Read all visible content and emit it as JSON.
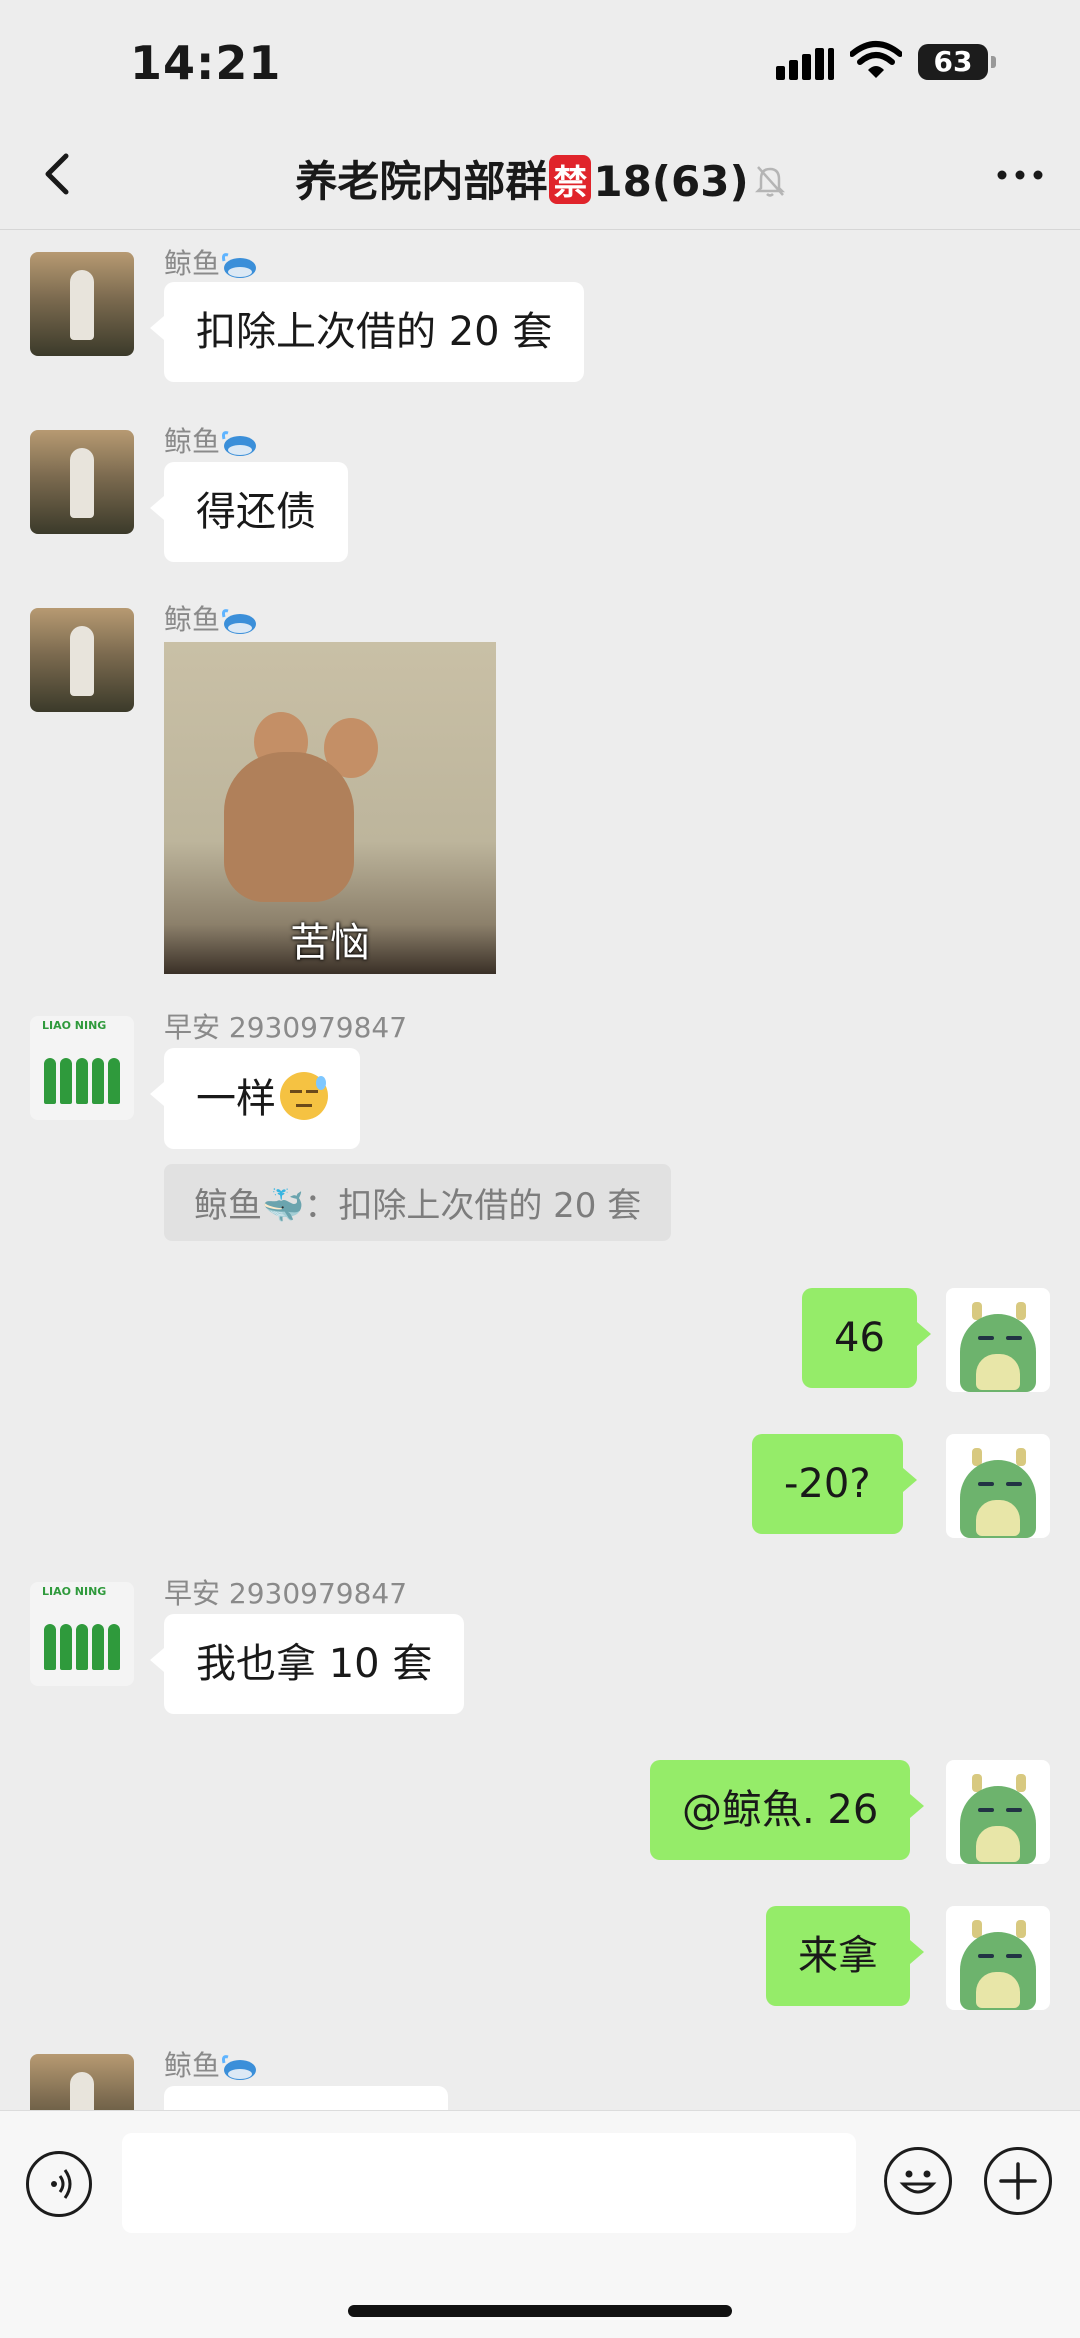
{
  "status_bar": {
    "time": "14:21",
    "battery": "63"
  },
  "header": {
    "title_prefix": "养老院内部群",
    "ban_char": "禁",
    "title_count": "18(63)",
    "icons": [
      "back-arrow-icon",
      "mute-bell-icon",
      "more-icon"
    ]
  },
  "messages": [
    {
      "sender": "鲸鱼",
      "text": "扣除上次借的 20 套",
      "direction": "in"
    },
    {
      "sender": "鲸鱼",
      "text": "得还债",
      "direction": "in"
    },
    {
      "sender": "鲸鱼",
      "sticker_caption": "苦恼",
      "direction": "in"
    },
    {
      "sender": "早安 2930979847",
      "text": "一样",
      "quote": "鲸鱼🐳：扣除上次借的 20 套",
      "direction": "in"
    },
    {
      "text": "46",
      "direction": "out"
    },
    {
      "text": "-20?",
      "direction": "out"
    },
    {
      "sender": "早安 2930979847",
      "text": "我也拿 10 套",
      "direction": "in"
    },
    {
      "text": "@鲸魚. 26",
      "direction": "out"
    },
    {
      "text": "来拿",
      "direction": "out"
    },
    {
      "sender": "鲸鱼",
      "direction": "in"
    }
  ],
  "colors": {
    "bubble_out": "#95ec69",
    "bubble_in": "#ffffff",
    "background": "#ededed",
    "ban_badge": "#e0242b"
  },
  "avatar_labels": {
    "team": "LIAO NING"
  },
  "input_bar": {
    "icons": [
      "voice-icon",
      "emoji-icon",
      "plus-icon"
    ]
  }
}
